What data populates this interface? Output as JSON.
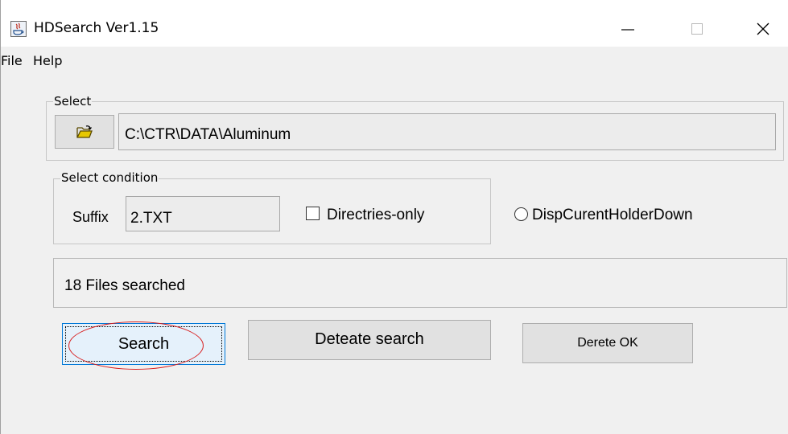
{
  "window": {
    "title": "HDSearch Ver1.15",
    "icons": {
      "app": "java-app-icon",
      "minimize": "minimize-icon",
      "maximize": "maximize-icon",
      "close": "close-icon"
    }
  },
  "menu": {
    "items": [
      {
        "label": "File"
      },
      {
        "label": "Help"
      }
    ]
  },
  "select": {
    "group_label": "Select",
    "folder_icon": "open-folder-icon",
    "path": "C:\\CTR\\DATA\\Aluminum"
  },
  "condition": {
    "group_label": "Select condition",
    "suffix_label": "Suffix",
    "suffix_value": "2.TXT",
    "directories_only_label": "Directries-only",
    "directories_only_checked": false,
    "disp_current_label": "DispCurentHolderDown",
    "disp_current_selected": false
  },
  "status": {
    "text": "18 Files searched"
  },
  "buttons": {
    "search": "Search",
    "deteate_search": "Deteate search",
    "derete_ok": "Derete OK"
  },
  "colors": {
    "focus_border": "#0078d7",
    "annotation_circle": "#d81e1e",
    "window_bg": "#f0f0f0"
  }
}
